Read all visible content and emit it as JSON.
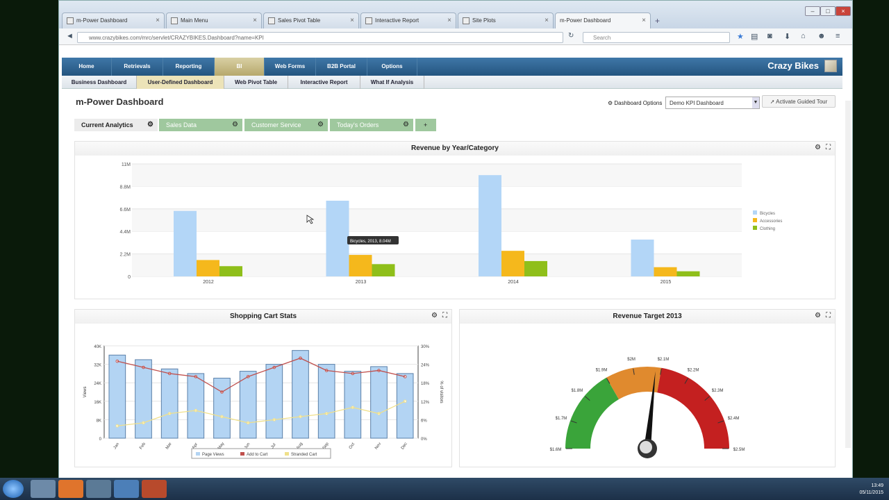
{
  "browser": {
    "tabs": [
      {
        "label": "m-Power Dashboard"
      },
      {
        "label": "Main Menu"
      },
      {
        "label": "Sales Pivot Table"
      },
      {
        "label": "Interactive Report"
      },
      {
        "label": "Site Plots"
      },
      {
        "label": "m-Power Dashboard"
      }
    ],
    "url": "www.crazybikes.com/mrc/servlet/CRAZYBIKES.Dashboard?name=KPI",
    "search_placeholder": "Search"
  },
  "app": {
    "brand": "Crazy Bikes",
    "menu": [
      "Home",
      "Retrievals",
      "Reporting",
      "BI",
      "Web Forms",
      "B2B Portal",
      "Options"
    ],
    "submenu": [
      "Business Dashboard",
      "User-Defined Dashboard",
      "Web Pivot Table",
      "Interactive Report",
      "What If Analysis"
    ],
    "page_title": "m-Power Dashboard",
    "dashboard_options_label": "Dashboard Options",
    "dashboard_select": "Demo KPI Dashboard",
    "tour_button": "Activate Guided Tour",
    "dash_tabs": [
      "Current Analytics",
      "Sales Data",
      "Customer Service",
      "Today's Orders"
    ],
    "add_tab": "+"
  },
  "panels": {
    "revenue_title": "Revenue by Year/Category",
    "cart_title": "Shopping Cart Stats",
    "target_title": "Revenue Target 2013"
  },
  "tooltip": "Bicycles, 2013, 8.04M",
  "taskbar": {
    "time": "13:49",
    "date": "05/11/2015"
  },
  "chart_data": [
    {
      "type": "bar",
      "title": "Revenue by Year/Category",
      "categories": [
        "2012",
        "2013",
        "2014",
        "2015"
      ],
      "series": [
        {
          "name": "Bicycles",
          "values": [
            6.4,
            7.4,
            9.9,
            3.6
          ]
        },
        {
          "name": "Accessories",
          "values": [
            1.6,
            2.1,
            2.5,
            0.9
          ]
        },
        {
          "name": "Clothing",
          "values": [
            1.0,
            1.2,
            1.5,
            0.5
          ]
        }
      ],
      "y_ticks": [
        "0",
        "2.2M",
        "4.4M",
        "6.6M",
        "8.8M",
        "11M"
      ],
      "ylim": [
        0,
        11
      ],
      "legend": "right",
      "colors": [
        "#b3d6f7",
        "#f5b81c",
        "#8fbf1a"
      ]
    },
    {
      "type": "bar",
      "title": "Shopping Cart Stats",
      "categories": [
        "Jan",
        "Feb",
        "Mar",
        "Apr",
        "May",
        "Jun",
        "Jul",
        "Aug",
        "Sep",
        "Oct",
        "Nov",
        "Dec"
      ],
      "series": [
        {
          "name": "Page Views",
          "values": [
            36,
            34,
            30,
            28,
            26,
            29,
            32,
            38,
            32,
            29,
            31,
            28
          ]
        },
        {
          "name": "Add to Cart",
          "values": [
            25,
            23,
            21,
            20,
            15,
            20,
            23,
            26,
            22,
            21,
            22,
            20
          ]
        },
        {
          "name": "Stranded Cart",
          "values": [
            4,
            5,
            8,
            9,
            7,
            5,
            6,
            7,
            8,
            10,
            8,
            12
          ]
        }
      ],
      "ylabel": "Views",
      "y2label": "% of visitors",
      "y_ticks": [
        "0",
        "8K",
        "16K",
        "24K",
        "32K",
        "40K"
      ],
      "y2_ticks": [
        "0%",
        "6%",
        "12%",
        "18%",
        "24%",
        "30%"
      ],
      "legend": "bottom"
    },
    {
      "type": "gauge",
      "title": "Revenue Target 2013",
      "labels": [
        "$1.6M",
        "$1.7M",
        "$1.8M",
        "$1.9M",
        "$2M",
        "$2.1M",
        "$2.2M",
        "$2.3M",
        "$2.4M",
        "$2.5M"
      ],
      "min": 1.6,
      "max": 2.5,
      "value": 2.08,
      "bands": [
        {
          "from": 1.6,
          "to": 1.9,
          "color": "#3aa43a"
        },
        {
          "from": 1.9,
          "to": 2.1,
          "color": "#e08a2e"
        },
        {
          "from": 2.1,
          "to": 2.5,
          "color": "#c42020"
        }
      ]
    }
  ]
}
